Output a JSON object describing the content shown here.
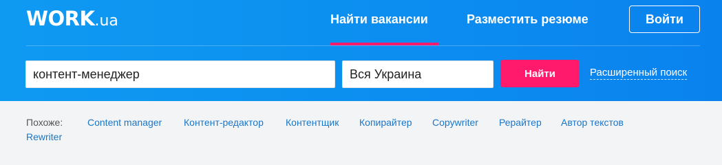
{
  "logo": {
    "main": "WORK",
    "domain": ".ua"
  },
  "nav": {
    "find_jobs": "Найти вакансии",
    "post_resume": "Разместить резюме",
    "login": "Войти"
  },
  "search": {
    "query": "контент-менеджер",
    "region": "Вся Украина",
    "button": "Найти",
    "advanced": "Расширенный поиск"
  },
  "similar": {
    "label": "Похоже:",
    "tags": [
      "Content manager",
      "Контент-редактор",
      "Контентщик",
      "Копирайтер",
      "Copywriter",
      "Рерайтер",
      "Автор текстов",
      "Rewriter"
    ]
  },
  "colors": {
    "header": "#0c8ff0",
    "accent": "#ff1a6b",
    "link": "#1a76c8"
  }
}
